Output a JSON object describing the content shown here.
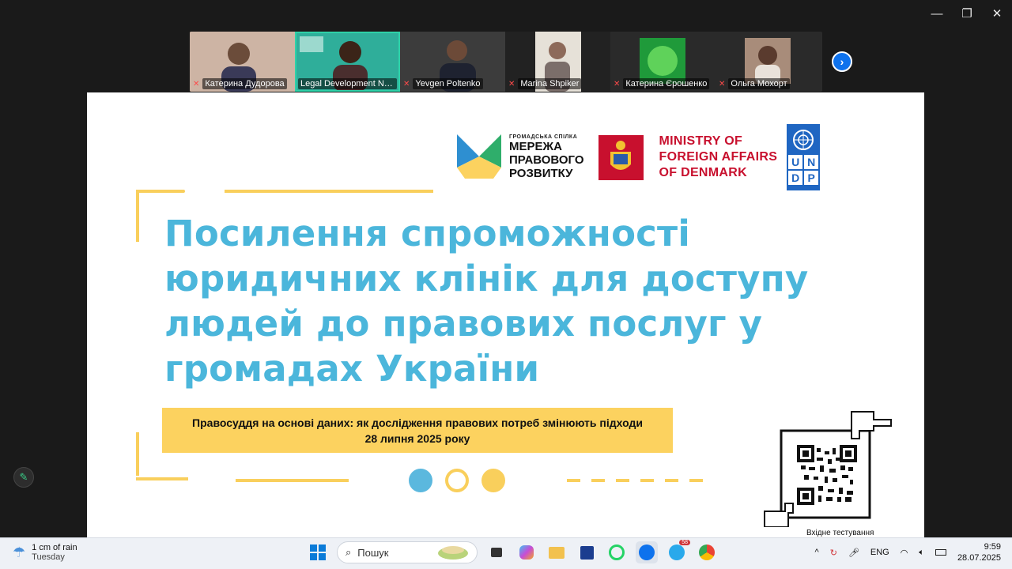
{
  "window": {
    "minimize": "—",
    "restore": "❐",
    "close": "✕"
  },
  "participants": [
    {
      "name": "Катерина Дудорова",
      "bg": "#c79e8a"
    },
    {
      "name": "Legal Development Netw...",
      "bg": "#2fae9a",
      "active": true
    },
    {
      "name": "Yevgen Poltenko",
      "bg": "#3c3c3c"
    },
    {
      "name": "Marina Shpiker",
      "bg": "#e6e1d8"
    },
    {
      "name": "Катерина Єрошенко",
      "bg": "#1f9a3a"
    },
    {
      "name": "Ольга Мохорт",
      "bg": "#8c6f5d"
    }
  ],
  "slide": {
    "logo_lpr": {
      "top": "ГРОМАДСЬКА СПІЛКА",
      "line1": "МЕРЕЖА",
      "line2": "ПРАВОВОГО",
      "line3": "РОЗВИТКУ"
    },
    "logo_dk": {
      "line1": "MINISTRY OF",
      "line2": "FOREIGN AFFAIRS",
      "line3": "OF DENMARK"
    },
    "logo_undp": {
      "u": "U",
      "n": "N",
      "d": "D",
      "p": "P"
    },
    "title": "Посилення спроможності юридичних клінік для доступу людей до правових послуг у громадах України",
    "subtitle_line1": "Правосуддя на основі даних: як дослідження правових потреб змінюють підходи",
    "subtitle_line2": "28 липня 2025 року",
    "qr_caption": "Вхідне тестування",
    "colors": {
      "title": "#4bb6db",
      "accent_yellow": "#f9cf5c",
      "dot_blue": "#5bb8de"
    }
  },
  "taskbar": {
    "weather_line1": "1 cm of rain",
    "weather_line2": "Tuesday",
    "search_placeholder": "Пошук",
    "telegram_badge": "58",
    "lang": "ENG",
    "time": "9:59",
    "date": "28.07.2025"
  }
}
